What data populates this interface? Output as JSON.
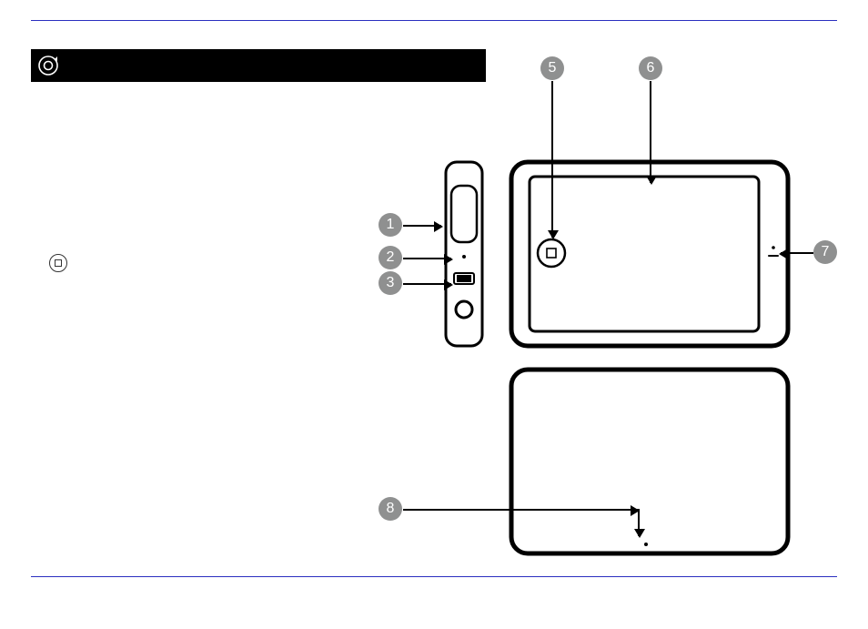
{
  "header": {
    "icon_name": "device-icon",
    "title": ""
  },
  "callouts": {
    "c1": "1",
    "c2": "2",
    "c3": "3",
    "c5": "5",
    "c6": "6",
    "c7": "7",
    "c8": "8"
  }
}
